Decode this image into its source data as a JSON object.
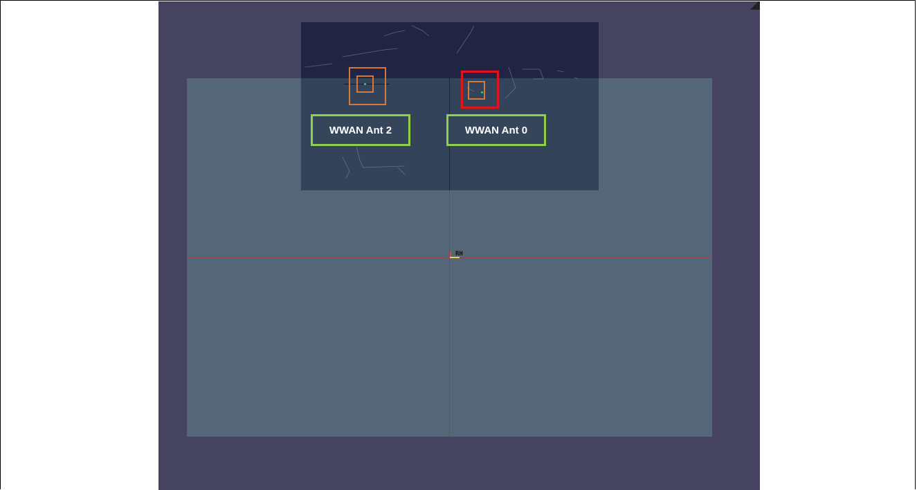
{
  "antennas": [
    {
      "label": "WWAN Ant 2",
      "highlighted": false
    },
    {
      "label": "WWAN Ant 0",
      "highlighted": true
    }
  ],
  "origin": {
    "label": "RH"
  },
  "colors": {
    "background": "#45435f",
    "board": "#546677",
    "label_border": "#8ed04a",
    "highlight_border": "#e0141e",
    "antenna_outline": "#d87838",
    "feed_point": "#3ed060"
  }
}
